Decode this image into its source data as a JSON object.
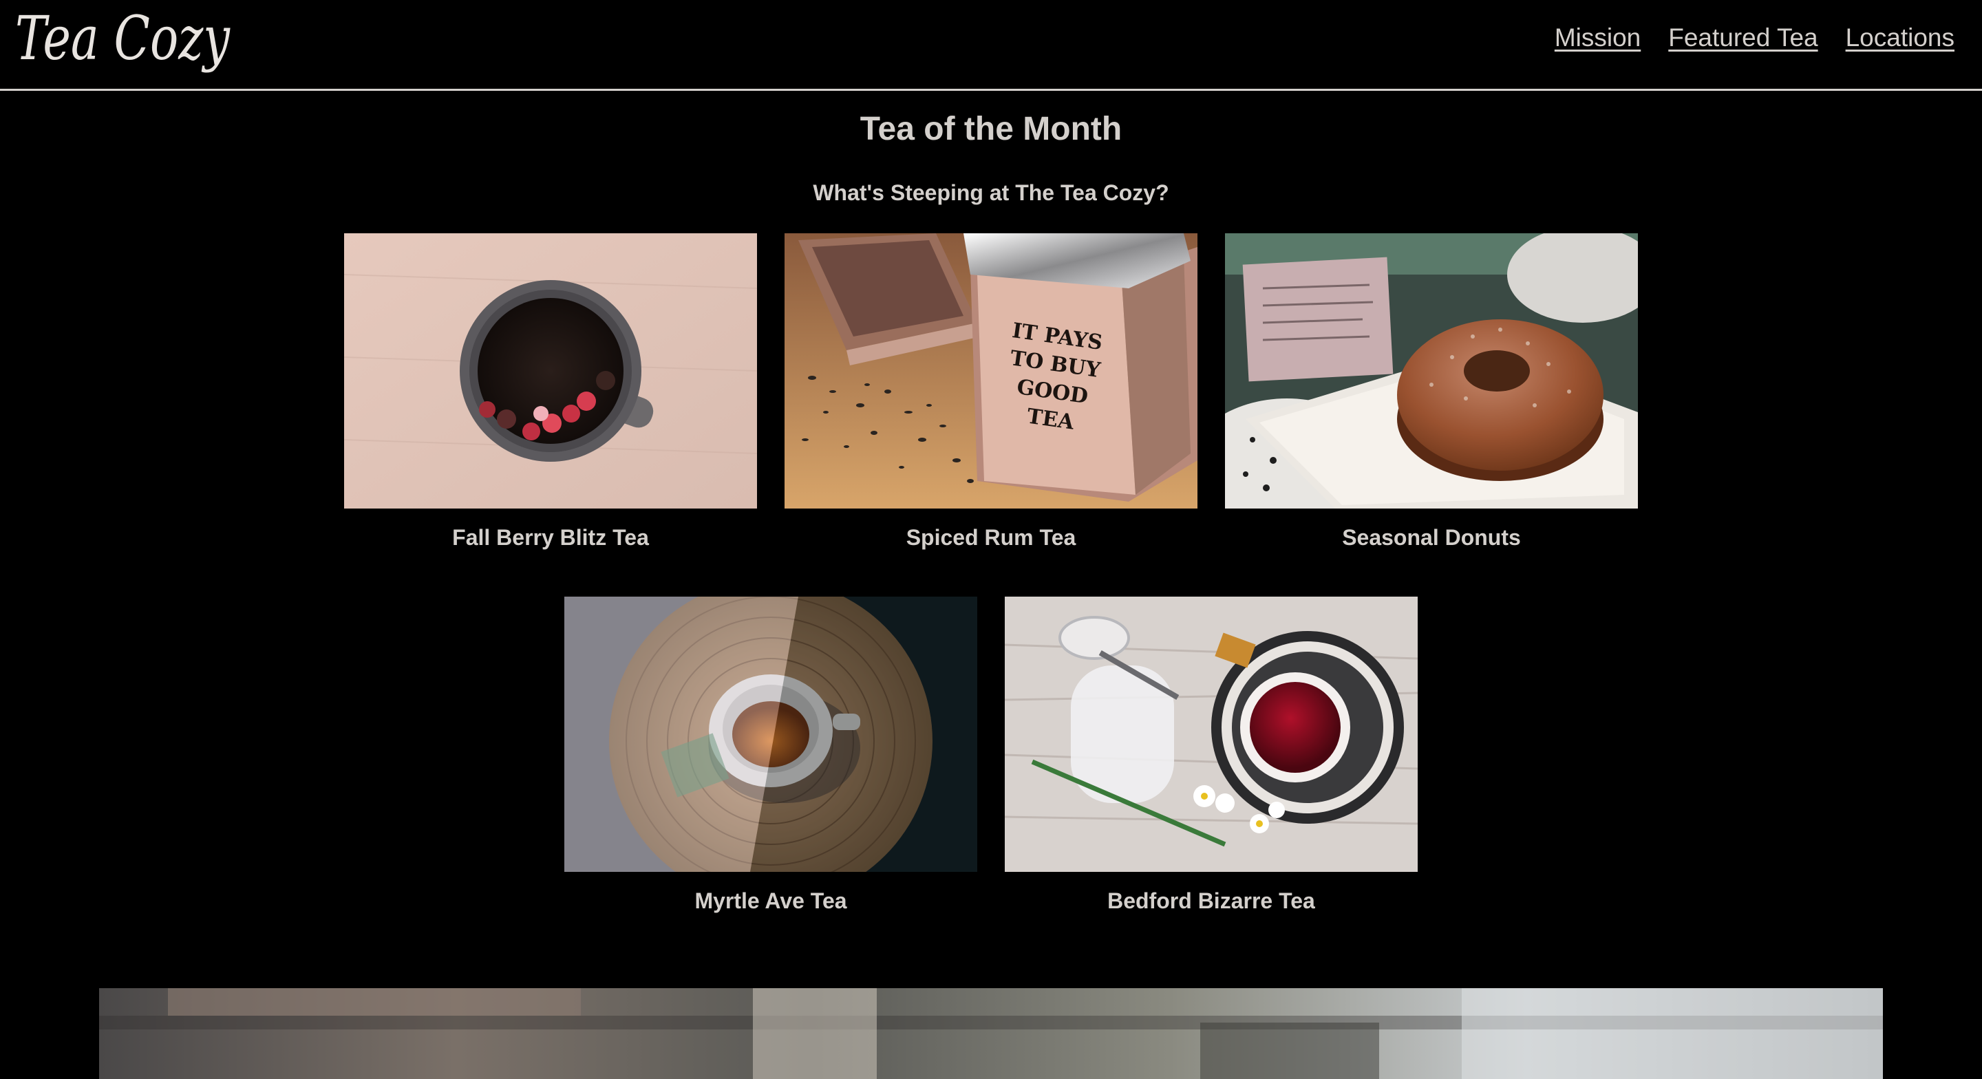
{
  "header": {
    "logo_text": "Tea Cozy",
    "nav": [
      {
        "label": "Mission"
      },
      {
        "label": "Featured Tea"
      },
      {
        "label": "Locations"
      }
    ]
  },
  "main": {
    "title": "Tea of the Month",
    "subtitle": "What's Steeping at The Tea Cozy?",
    "teas": [
      {
        "name": "Fall Berry Blitz Tea"
      },
      {
        "name": "Spiced Rum Tea"
      },
      {
        "name": "Seasonal Donuts"
      },
      {
        "name": "Myrtle Ave Tea"
      },
      {
        "name": "Bedford Bizarre Tea"
      }
    ],
    "box_label": [
      "IT PAYS",
      "TO BUY",
      "GOOD",
      "TEA"
    ]
  },
  "colors": {
    "background": "#000000",
    "text": "#d4d0cc"
  }
}
